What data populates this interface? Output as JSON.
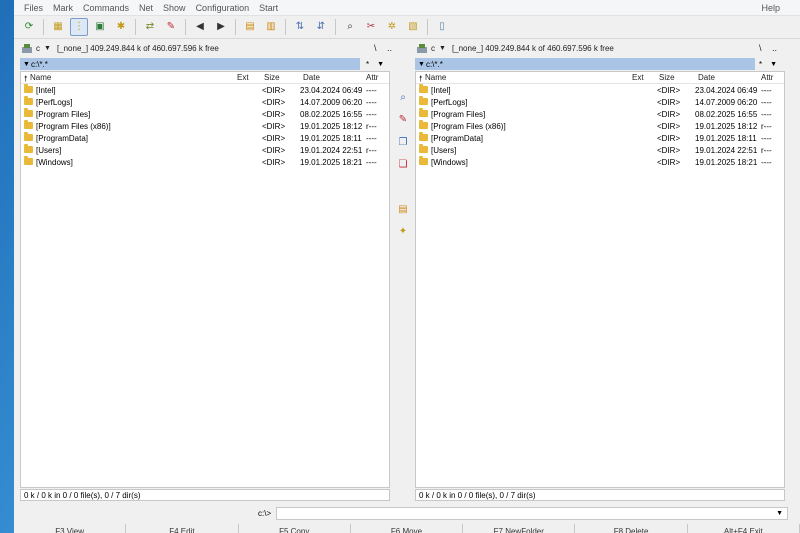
{
  "menu": {
    "items": [
      "Files",
      "Mark",
      "Commands",
      "Net",
      "Show",
      "Configuration",
      "Start"
    ],
    "help": "Help"
  },
  "toolbar": {
    "buttons": [
      {
        "name": "refresh-icon",
        "glyph": "⟳",
        "color": "#2c8a2c"
      },
      {
        "name": "brief-view-icon",
        "glyph": "▦",
        "color": "#c49a1a"
      },
      {
        "name": "tree-view-icon",
        "glyph": "⋮",
        "color": "#c49a1a",
        "pressed": true
      },
      {
        "name": "thumbnails-icon",
        "glyph": "▣",
        "color": "#2e7b3a"
      },
      {
        "name": "select-group-icon",
        "glyph": "✱",
        "color": "#c49a1a"
      },
      {
        "name": "invert-selection-icon",
        "glyph": "⇄",
        "color": "#7a8a2a"
      },
      {
        "name": "separate-tree-icon",
        "glyph": "✎",
        "color": "#c0282d"
      },
      {
        "name": "back-icon",
        "glyph": "◀",
        "color": "#333"
      },
      {
        "name": "forward-icon",
        "glyph": "▶",
        "color": "#333"
      },
      {
        "name": "pack-icon",
        "glyph": "▤",
        "color": "#d08a10"
      },
      {
        "name": "unpack-icon",
        "glyph": "▥",
        "color": "#d08a10"
      },
      {
        "name": "ftp-connect-icon",
        "glyph": "⇅",
        "color": "#4a6fb0"
      },
      {
        "name": "ftp-new-connection-icon",
        "glyph": "⇵",
        "color": "#4a6fb0"
      },
      {
        "name": "search-icon",
        "glyph": "⌕",
        "color": "#333"
      },
      {
        "name": "multi-rename-icon",
        "glyph": "✂",
        "color": "#b03040"
      },
      {
        "name": "sync-dirs-icon",
        "glyph": "✲",
        "color": "#c49a1a"
      },
      {
        "name": "copy-names-icon",
        "glyph": "▧",
        "color": "#c49a1a"
      },
      {
        "name": "notepad-icon",
        "glyph": "▯",
        "color": "#5a8ab0"
      }
    ]
  },
  "left": {
    "drive": "c",
    "drive_info": "[_none_]  409.249.844 k of 460.697.596 k free",
    "root": "\\",
    "up": "..",
    "path": "c:\\*.*",
    "path_side": "*",
    "columns": {
      "name": "Name",
      "ext": "Ext",
      "size": "Size",
      "date": "Date",
      "attr": "Attr"
    },
    "rows": [
      {
        "name": "[Intel]",
        "size": "<DIR>",
        "date": "23.04.2024 06:49",
        "attr": "----"
      },
      {
        "name": "[PerfLogs]",
        "size": "<DIR>",
        "date": "14.07.2009 06:20",
        "attr": "----"
      },
      {
        "name": "[Program Files]",
        "size": "<DIR>",
        "date": "08.02.2025 16:55",
        "attr": "----"
      },
      {
        "name": "[Program Files (x86)]",
        "size": "<DIR>",
        "date": "19.01.2025 18:12",
        "attr": "r---"
      },
      {
        "name": "[ProgramData]",
        "size": "<DIR>",
        "date": "19.01.2025 18:11",
        "attr": "----"
      },
      {
        "name": "[Users]",
        "size": "<DIR>",
        "date": "19.01.2024 22:51",
        "attr": "r---"
      },
      {
        "name": "[Windows]",
        "size": "<DIR>",
        "date": "19.01.2025 18:21",
        "attr": "----"
      }
    ],
    "status": "0 k / 0 k in 0 / 0 file(s), 0 / 7 dir(s)"
  },
  "right": {
    "drive": "c",
    "drive_info": "[_none_]  409.249.844 k of 460.697.596 k free",
    "root": "\\",
    "up": "..",
    "path": "c:\\*.*",
    "path_side": "*",
    "columns": {
      "name": "Name",
      "ext": "Ext",
      "size": "Size",
      "date": "Date",
      "attr": "Attr"
    },
    "rows": [
      {
        "name": "[Intel]",
        "size": "<DIR>",
        "date": "23.04.2024 06:49",
        "attr": "----"
      },
      {
        "name": "[PerfLogs]",
        "size": "<DIR>",
        "date": "14.07.2009 06:20",
        "attr": "----"
      },
      {
        "name": "[Program Files]",
        "size": "<DIR>",
        "date": "08.02.2025 16:55",
        "attr": "----"
      },
      {
        "name": "[Program Files (x86)]",
        "size": "<DIR>",
        "date": "19.01.2025 18:12",
        "attr": "r---"
      },
      {
        "name": "[ProgramData]",
        "size": "<DIR>",
        "date": "19.01.2025 18:11",
        "attr": "----"
      },
      {
        "name": "[Users]",
        "size": "<DIR>",
        "date": "19.01.2024 22:51",
        "attr": "r---"
      },
      {
        "name": "[Windows]",
        "size": "<DIR>",
        "date": "19.01.2025 18:21",
        "attr": "----"
      }
    ],
    "status": "0 k / 0 k in 0 / 0 file(s), 0 / 7 dir(s)"
  },
  "middle": {
    "buttons": [
      {
        "name": "view-file-icon",
        "glyph": "⌕",
        "color": "#3a6fb6"
      },
      {
        "name": "edit-file-icon",
        "glyph": "✎",
        "color": "#c0282d"
      },
      {
        "name": "copy-file-icon",
        "glyph": "❐",
        "color": "#3a6fb6"
      },
      {
        "name": "move-file-icon",
        "glyph": "❏",
        "color": "#c0282d"
      },
      {
        "name": "pack-files-icon",
        "glyph": "▤",
        "color": "#d08a10"
      },
      {
        "name": "new-folder-icon",
        "glyph": "✦",
        "color": "#c49a1a"
      }
    ]
  },
  "cmdline": {
    "label": "c:\\>",
    "value": ""
  },
  "fkeys": [
    "F3 View",
    "F4 Edit",
    "F5 Copy",
    "F6 Move",
    "F7 NewFolder",
    "F8 Delete",
    "Alt+F4 Exit"
  ]
}
